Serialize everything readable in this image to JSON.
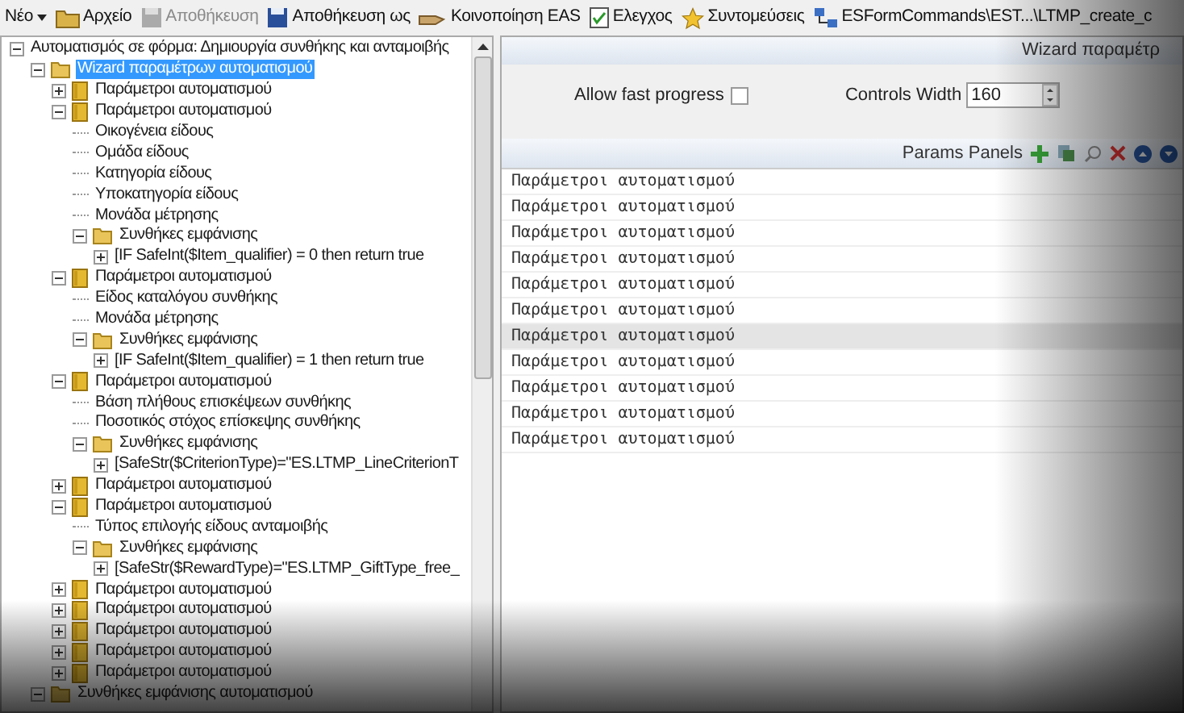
{
  "toolbar": {
    "items": [
      {
        "kind": "menu",
        "label": "Νέο",
        "disabled": false
      },
      {
        "kind": "folder",
        "label": "Αρχείο",
        "disabled": false
      },
      {
        "kind": "save",
        "label": "Αποθήκευση",
        "disabled": true
      },
      {
        "kind": "saveas",
        "label": "Αποθήκευση ως",
        "disabled": false
      },
      {
        "kind": "share",
        "label": "Κοινοποίηση EAS",
        "disabled": false
      },
      {
        "kind": "check",
        "label": "Ελεγχος",
        "disabled": false
      },
      {
        "kind": "star",
        "label": "Συντομεύσεις",
        "disabled": false
      },
      {
        "kind": "path",
        "label": "ESFormCommands\\EST...\\LTMP_create_c",
        "disabled": false
      }
    ]
  },
  "tree": {
    "items": [
      {
        "kind": "root",
        "label": "Αυτοματισμός σε φόρμα: Δημιουργία συνθήκης και ανταμοιβής",
        "expanded": true,
        "selected": false,
        "children": [
          {
            "kind": "folder",
            "label": "Wizard παραμέτρων αυτοματισμού",
            "expanded": true,
            "selected": true,
            "children": [
              {
                "kind": "params",
                "label": "Παράμετροι αυτοματισμού",
                "expanded": false,
                "selected": false
              },
              {
                "kind": "params",
                "label": "Παράμετροι αυτοματισμού",
                "expanded": true,
                "selected": false,
                "children": [
                  {
                    "kind": "leaf",
                    "label": "Οικογένεια είδους"
                  },
                  {
                    "kind": "leaf",
                    "label": "Ομάδα είδους"
                  },
                  {
                    "kind": "leaf",
                    "label": "Κατηγορία είδους"
                  },
                  {
                    "kind": "leaf",
                    "label": "Υποκατηγορία είδους"
                  },
                  {
                    "kind": "leaf",
                    "label": "Μονάδα μέτρησης"
                  },
                  {
                    "kind": "folder",
                    "label": "Συνθήκες εμφάνισης",
                    "expanded": true,
                    "selected": false,
                    "children": [
                      {
                        "kind": "condition",
                        "label": "[IF SafeInt($Item_qualifier) = 0 then return true",
                        "expanded": false,
                        "selected": false
                      }
                    ]
                  }
                ]
              },
              {
                "kind": "params",
                "label": "Παράμετροι αυτοματισμού",
                "expanded": true,
                "selected": false,
                "children": [
                  {
                    "kind": "leaf",
                    "label": "Είδος καταλόγου συνθήκης"
                  },
                  {
                    "kind": "leaf",
                    "label": "Μονάδα μέτρησης"
                  },
                  {
                    "kind": "folder",
                    "label": "Συνθήκες εμφάνισης",
                    "expanded": true,
                    "selected": false,
                    "children": [
                      {
                        "kind": "condition",
                        "label": "[IF SafeInt($Item_qualifier) = 1 then return true",
                        "expanded": false,
                        "selected": false
                      }
                    ]
                  }
                ]
              },
              {
                "kind": "params",
                "label": "Παράμετροι αυτοματισμού",
                "expanded": true,
                "selected": false,
                "children": [
                  {
                    "kind": "leaf",
                    "label": "Βάση πλήθους επισκέψεων συνθήκης"
                  },
                  {
                    "kind": "leaf",
                    "label": "Ποσοτικός στόχος επίσκεψης συνθήκης"
                  },
                  {
                    "kind": "folder",
                    "label": "Συνθήκες εμφάνισης",
                    "expanded": true,
                    "selected": false,
                    "children": [
                      {
                        "kind": "condition",
                        "label": "[SafeStr($CriterionType)=\"ES.LTMP_LineCriterionT",
                        "expanded": false,
                        "selected": false
                      }
                    ]
                  }
                ]
              },
              {
                "kind": "params",
                "label": "Παράμετροι αυτοματισμού",
                "expanded": false,
                "selected": false
              },
              {
                "kind": "params",
                "label": "Παράμετροι αυτοματισμού",
                "expanded": true,
                "selected": false,
                "children": [
                  {
                    "kind": "leaf",
                    "label": "Τύπος επιλογής είδους ανταμοιβής"
                  },
                  {
                    "kind": "folder",
                    "label": "Συνθήκες εμφάνισης",
                    "expanded": true,
                    "selected": false,
                    "children": [
                      {
                        "kind": "condition",
                        "label": "[SafeStr($RewardType)=\"ES.LTMP_GiftType_free_",
                        "expanded": false,
                        "selected": false
                      }
                    ]
                  }
                ]
              },
              {
                "kind": "params",
                "label": "Παράμετροι αυτοματισμού",
                "expanded": false,
                "selected": false
              },
              {
                "kind": "params",
                "label": "Παράμετροι αυτοματισμού",
                "expanded": false,
                "selected": false
              },
              {
                "kind": "params",
                "label": "Παράμετροι αυτοματισμού",
                "expanded": false,
                "selected": false
              },
              {
                "kind": "params",
                "label": "Παράμετροι αυτοματισμού",
                "expanded": false,
                "selected": false
              },
              {
                "kind": "params",
                "label": "Παράμετροι αυτοματισμού",
                "expanded": false,
                "selected": false
              }
            ]
          },
          {
            "kind": "folder",
            "label": "Συνθήκες εμφάνισης αυτοματισμού",
            "expanded": true,
            "selected": false
          }
        ]
      }
    ]
  },
  "panel": {
    "title": "Wizard παραμέτρ",
    "options": {
      "fast_progress": {
        "label": "Allow fast progress",
        "checked": false
      },
      "controls_width": {
        "label": "Controls Width",
        "value": "160"
      }
    },
    "params_toolbar": {
      "label": "Params Panels"
    },
    "rows": [
      {
        "label": "Παράμετροι αυτοματισμού",
        "selected": false
      },
      {
        "label": "Παράμετροι αυτοματισμού",
        "selected": false
      },
      {
        "label": "Παράμετροι αυτοματισμού",
        "selected": false
      },
      {
        "label": "Παράμετροι αυτοματισμού",
        "selected": false
      },
      {
        "label": "Παράμετροι αυτοματισμού",
        "selected": false
      },
      {
        "label": "Παράμετροι αυτοματισμού",
        "selected": false
      },
      {
        "label": "Παράμετροι αυτοματισμού",
        "selected": true
      },
      {
        "label": "Παράμετροι αυτοματισμού",
        "selected": false
      },
      {
        "label": "Παράμετροι αυτοματισμού",
        "selected": false
      },
      {
        "label": "Παράμετροι αυτοματισμού",
        "selected": false
      },
      {
        "label": "Παράμετροι αυτοματισμού",
        "selected": false
      }
    ]
  }
}
